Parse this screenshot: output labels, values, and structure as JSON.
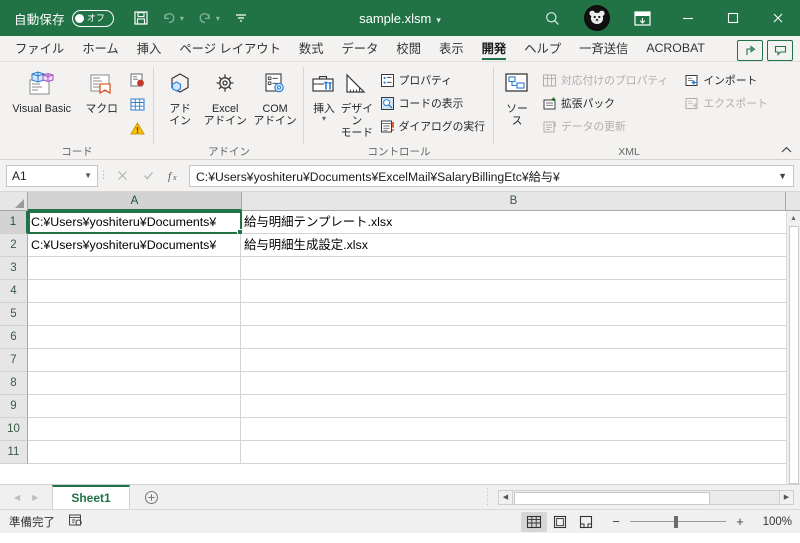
{
  "titlebar": {
    "autosave_label": "自動保存",
    "autosave_state": "オフ",
    "document_title": "sample.xlsm",
    "icons": {
      "save": "save-icon",
      "undo": "undo-icon",
      "redo": "redo-icon",
      "qat_more": "qat-customize-icon",
      "search": "search-icon",
      "ribbon_display": "ribbon-display-options-icon",
      "minimize": "minimize-icon",
      "maximize": "maximize-icon",
      "close": "close-icon"
    }
  },
  "tabs": [
    {
      "label": "ファイル",
      "active": false
    },
    {
      "label": "ホーム",
      "active": false
    },
    {
      "label": "挿入",
      "active": false
    },
    {
      "label": "ページ レイアウト",
      "active": false
    },
    {
      "label": "数式",
      "active": false
    },
    {
      "label": "データ",
      "active": false
    },
    {
      "label": "校閲",
      "active": false
    },
    {
      "label": "表示",
      "active": false
    },
    {
      "label": "開発",
      "active": true
    },
    {
      "label": "ヘルプ",
      "active": false
    },
    {
      "label": "一斉送信",
      "active": false
    },
    {
      "label": "ACROBAT",
      "active": false
    }
  ],
  "ribbon": {
    "groups": {
      "code": {
        "label": "コード",
        "visual_basic": "Visual Basic",
        "macro": "マクロ",
        "record_macro_icon": "record-macro-icon",
        "use_relative_icon": "use-relative-references-icon",
        "macro_security_icon": "macro-security-icon"
      },
      "addins": {
        "label": "アドイン",
        "addin": "アド\nイン",
        "addin_line1": "アド",
        "addin_line2": "イン",
        "excel_addin_line1": "Excel",
        "excel_addin_line2": "アドイン",
        "com_addin_line1": "COM",
        "com_addin_line2": "アドイン"
      },
      "controls": {
        "label": "コントロール",
        "insert_line1": "挿入",
        "design_mode_line1": "デザイン",
        "design_mode_line2": "モード",
        "properties": "プロパティ",
        "view_code": "コードの表示",
        "run_dialog": "ダイアログの実行"
      },
      "xml": {
        "label": "XML",
        "source_label": "ソース",
        "map_properties": "対応付けのプロパティ",
        "expansion_packs": "拡張パック",
        "refresh_data": "データの更新",
        "import": "インポート",
        "export": "エクスポート"
      }
    },
    "collapse_icon": "chevron-up-icon"
  },
  "formulabar": {
    "namebox_value": "A1",
    "cancel_icon": "cancel-icon",
    "enter_icon": "enter-icon",
    "function_icon": "insert-function-icon",
    "formula_value": "C:¥Users¥yoshiteru¥Documents¥ExcelMail¥SalaryBillingEtc¥給与¥",
    "expand_icon": "chevron-down-icon"
  },
  "grid": {
    "columns": [
      "A",
      "B"
    ],
    "active_column": "A",
    "active_row": 1,
    "rows": [
      {
        "num": "1",
        "a_clipped": "C:¥Users¥yoshiteru¥Documents¥",
        "spill": "給与明細テンプレート.xlsx"
      },
      {
        "num": "2",
        "a_clipped": "C:¥Users¥yoshiteru¥Documents¥",
        "spill": "給与明細生成設定.xlsx"
      },
      {
        "num": "3",
        "a_clipped": "",
        "spill": ""
      },
      {
        "num": "4",
        "a_clipped": "",
        "spill": ""
      },
      {
        "num": "5",
        "a_clipped": "",
        "spill": ""
      },
      {
        "num": "6",
        "a_clipped": "",
        "spill": ""
      },
      {
        "num": "7",
        "a_clipped": "",
        "spill": ""
      },
      {
        "num": "8",
        "a_clipped": "",
        "spill": ""
      },
      {
        "num": "9",
        "a_clipped": "",
        "spill": ""
      },
      {
        "num": "10",
        "a_clipped": "",
        "spill": ""
      },
      {
        "num": "11",
        "a_clipped": "",
        "spill": ""
      }
    ]
  },
  "sheetbar": {
    "prev_icon": "prev-sheet-icon",
    "next_icon": "next-sheet-icon",
    "sheet_name": "Sheet1",
    "add_sheet_icon": "add-sheet-icon"
  },
  "statusbar": {
    "status_text": "準備完了",
    "accessibility_icon": "accessibility-checker-icon",
    "normal_view_icon": "normal-view-icon",
    "page_layout_icon": "page-layout-view-icon",
    "page_break_icon": "page-break-preview-icon",
    "zoom_out": "−",
    "zoom_in": "+",
    "zoom_value": "100%"
  },
  "colors": {
    "accent": "#217346",
    "ribbon_bg": "#f3f2f1",
    "grid_header": "#e6e6e6"
  }
}
